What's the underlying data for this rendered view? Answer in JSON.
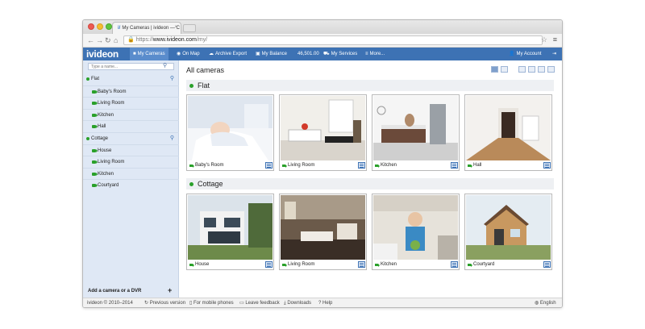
{
  "browser": {
    "tab_title": "My Cameras | ivideon — C",
    "tab_close": "×",
    "url_scheme": "https://",
    "url_host": "www.ivideon.com",
    "url_path": "/my/"
  },
  "appnav": {
    "logo": "ivideon",
    "items": [
      {
        "icon": "■",
        "label": "My Cameras",
        "active": true
      },
      {
        "icon": "◉",
        "label": "On Map"
      },
      {
        "icon": "☁",
        "label": "Archive Export"
      },
      {
        "icon": "▣",
        "label": "My Balance"
      },
      {
        "icon": "",
        "label": "46,501.00"
      },
      {
        "icon": "⛟",
        "label": "My Services"
      },
      {
        "icon": "≡",
        "label": "More..."
      }
    ],
    "account": "My Account",
    "logout_icon": "⇥"
  },
  "sidebar": {
    "search_placeholder": "Type a name...",
    "groups": [
      {
        "name": "Flat",
        "cameras": [
          "Baby's Room",
          "Living Room",
          "Kitchen",
          "Hall"
        ]
      },
      {
        "name": "Cottage",
        "cameras": [
          "House",
          "Living Room",
          "Kitchen",
          "Courtyard"
        ]
      }
    ],
    "add_label": "Add a camera or a DVR",
    "add_icon": "+"
  },
  "main": {
    "title": "All cameras",
    "sections": [
      {
        "name": "Flat",
        "cameras": [
          "Baby's Room",
          "Living Room",
          "Kitchen",
          "Hall"
        ]
      },
      {
        "name": "Cottage",
        "cameras": [
          "House",
          "Living Room",
          "Kitchen",
          "Courtyard"
        ]
      }
    ]
  },
  "footer": {
    "copyright": "ivideon © 2010–2014",
    "previous": "Previous version",
    "mobile": "For mobile phones",
    "feedback": "Leave feedback",
    "downloads": "Downloads",
    "help": "Help",
    "language": "English"
  },
  "colors": {
    "accent": "#3d72b4",
    "status_online": "#2aa02a",
    "sidebar_bg": "#dfe8f5"
  }
}
